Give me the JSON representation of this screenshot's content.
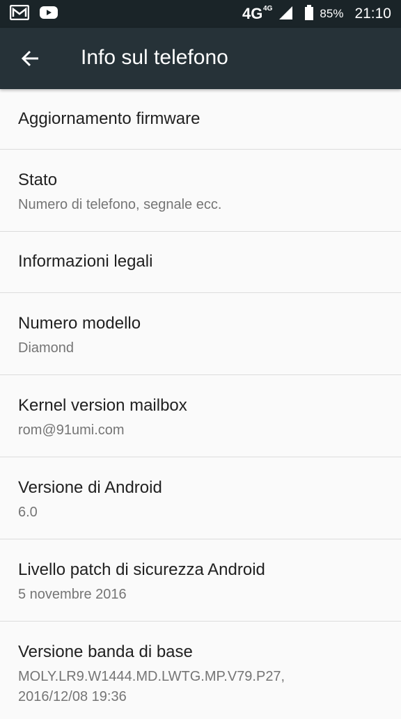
{
  "status_bar": {
    "network": "4G",
    "network_small": "4G",
    "battery": "85%",
    "time": "21:10",
    "icons": [
      "gmail-icon",
      "youtube-icon",
      "signal-icon",
      "battery-icon"
    ]
  },
  "app_bar": {
    "title": "Info sul telefono",
    "back_icon": "arrow-back-icon"
  },
  "items": [
    {
      "title": "Aggiornamento firmware"
    },
    {
      "title": "Stato",
      "summary": "Numero di telefono, segnale ecc."
    },
    {
      "title": "Informazioni legali"
    },
    {
      "title": "Numero modello",
      "summary": "Diamond"
    },
    {
      "title": "Kernel version mailbox",
      "summary": "rom@91umi.com"
    },
    {
      "title": "Versione di Android",
      "summary": "6.0"
    },
    {
      "title": "Livello patch di sicurezza Android",
      "summary": "5 novembre 2016"
    },
    {
      "title": "Versione banda di base",
      "summary_line1": "MOLY.LR9.W1444.MD.LWTG.MP.V79.P27,",
      "summary_line2": "2016/12/08 19:36"
    }
  ],
  "colors": {
    "status_bar": "#1a2428",
    "app_bar": "#263238",
    "background": "#fafafa",
    "divider": "#dcdcdc",
    "primary_text": "#212121",
    "secondary_text": "#757575"
  }
}
